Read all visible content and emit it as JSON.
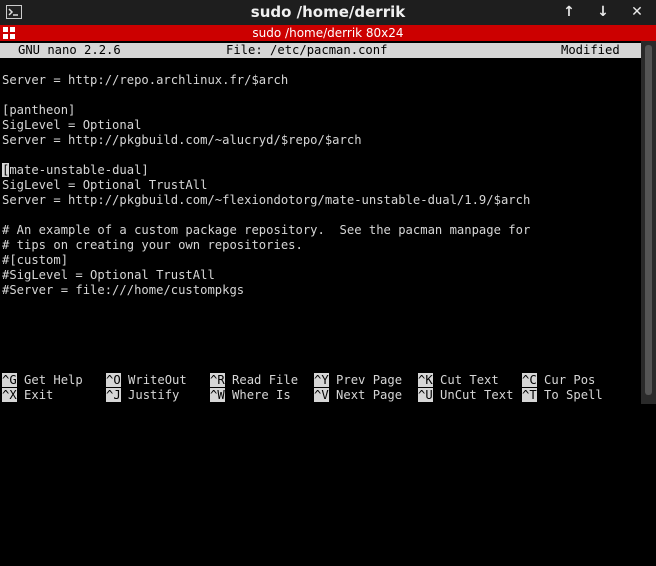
{
  "window": {
    "title": "sudo  /home/derrik",
    "up_icon": "↑",
    "down_icon": "↓",
    "close_icon": "✕"
  },
  "tabbar": {
    "title": "sudo  /home/derrik 80x24"
  },
  "nano": {
    "version": "GNU nano 2.2.6",
    "file": "File: /etc/pacman.conf",
    "status": "Modified"
  },
  "lines": [
    "",
    "Server = http://repo.archlinux.fr/$arch",
    "",
    "[pantheon]",
    "SigLevel = Optional",
    "Server = http://pkgbuild.com/~alucryd/$repo/$arch",
    "",
    "mate-unstable-dual]",
    "SigLevel = Optional TrustAll",
    "Server = http://pkgbuild.com/~flexiondotorg/mate-unstable-dual/1.9/$arch",
    "",
    "# An example of a custom package repository.  See the pacman manpage for",
    "# tips on creating your own repositories.",
    "#[custom]",
    "#SigLevel = Optional TrustAll",
    "#Server = file:///home/custompkgs"
  ],
  "cursor_char": "[",
  "shortcuts": {
    "row1": [
      {
        "key": "^G",
        "label": "Get Help"
      },
      {
        "key": "^O",
        "label": "WriteOut"
      },
      {
        "key": "^R",
        "label": "Read File"
      },
      {
        "key": "^Y",
        "label": "Prev Page"
      },
      {
        "key": "^K",
        "label": "Cut Text"
      },
      {
        "key": "^C",
        "label": "Cur Pos"
      }
    ],
    "row2": [
      {
        "key": "^X",
        "label": "Exit"
      },
      {
        "key": "^J",
        "label": "Justify"
      },
      {
        "key": "^W",
        "label": "Where Is"
      },
      {
        "key": "^V",
        "label": "Next Page"
      },
      {
        "key": "^U",
        "label": "UnCut Text"
      },
      {
        "key": "^T",
        "label": "To Spell"
      }
    ]
  }
}
